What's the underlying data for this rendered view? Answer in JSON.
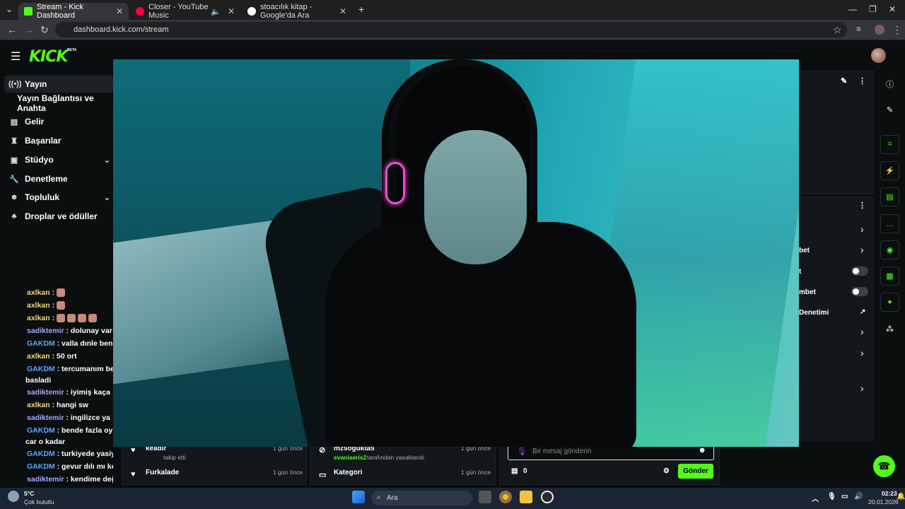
{
  "browser": {
    "tabs": [
      {
        "title": "Stream - Kick Dashboard",
        "active": true
      },
      {
        "title": "Closer - YouTube Music",
        "active": false
      },
      {
        "title": "stoacılık kitap - Google'da Ara",
        "active": false
      }
    ],
    "url": "dashboard.kick.com/stream"
  },
  "sidebar": {
    "items": [
      {
        "label": "Yayın",
        "icon": "broadcast-icon"
      },
      {
        "label": "Yayın Bağlantısı ve Anahta"
      },
      {
        "label": "Gelir",
        "icon": "chart-icon"
      },
      {
        "label": "Başarılar",
        "icon": "trophy-icon"
      },
      {
        "label": "Stüdyo",
        "icon": "studio-icon"
      },
      {
        "label": "Denetleme",
        "icon": "wrench-icon"
      },
      {
        "label": "Topluluk",
        "icon": "community-icon"
      },
      {
        "label": "Droplar ve ödüller",
        "icon": "gift-icon"
      }
    ]
  },
  "chat": {
    "messages": [
      {
        "user": "axlkan",
        "text": ":"
      },
      {
        "user": "axlkan",
        "text": ":"
      },
      {
        "user": "axlkan",
        "text": ":"
      },
      {
        "user": "sadiktemir",
        "text": ": dolunay var"
      },
      {
        "user": "GAKDM",
        "text": ": valla dınle ben"
      },
      {
        "user": "axlkan",
        "text": ": 50 ort"
      },
      {
        "user": "GAKDM",
        "text": ": tercumanım be",
        "cont": "basladi"
      },
      {
        "user": "sadiktemir",
        "text": ": iyimiş kaça"
      },
      {
        "user": "axlkan",
        "text": ": hangi sw"
      },
      {
        "user": "sadiktemir",
        "text": ": ingilizce ya"
      },
      {
        "user": "GAKDM",
        "text": ": bende fazla oy",
        "cont": "car o kadar"
      },
      {
        "user": "GAKDM",
        "text": ": turkiyede yasiyom dogrudur"
      },
      {
        "user": "GAKDM",
        "text": ": gevur dılı mı konuscaz bı de oglum"
      },
      {
        "user": "sadiktemir",
        "text": ": kendime değil arkaşaım arıyo"
      }
    ]
  },
  "right_panel": {
    "rows": [
      "bet",
      "t",
      "mbet",
      "Denetimi"
    ]
  },
  "activity": {
    "items": [
      {
        "name": "keadir",
        "desc": "takip etti",
        "time": "1 gün önce"
      },
      {
        "name": "Furkalade",
        "desc": "",
        "time": "1 gün önce"
      }
    ],
    "mod": [
      {
        "name": "mzsoguktas",
        "desc_user": "evaniaeris2",
        "desc": "tarafından yasaklandı",
        "time": "1 gün önce"
      },
      {
        "name": "Kategori",
        "desc": "",
        "time": "1 gün önce"
      }
    ]
  },
  "chat_input": {
    "placeholder": "Bir mesaj gönderin",
    "points": "0",
    "send_label": "Gönder"
  },
  "taskbar": {
    "weather_temp": "5°C",
    "weather_desc": "Çok bulutlu",
    "search": "Ara",
    "time": "02:23",
    "date": "20.01.2026"
  },
  "colors": {
    "accent": "#53fc18",
    "bg": "#0b0e0f"
  }
}
